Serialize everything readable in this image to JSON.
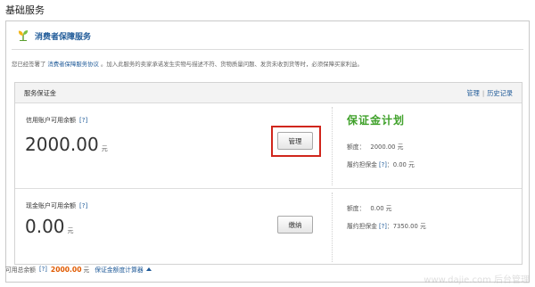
{
  "page": {
    "title": "基础服务"
  },
  "brand": {
    "title": "消费者保障服务",
    "icon": "sprout-icon"
  },
  "notice": {
    "prefix": "您已经签署了",
    "agreement_link": "消费者保障服务协议",
    "suffix": "。加入此服务的卖家承诺发生实物与描述不符、货物质量问题、发货未收到货等时，必须保障买家利益。"
  },
  "panel": {
    "title": "服务保证金",
    "links": [
      {
        "label": "管理"
      },
      {
        "label": "历史记录"
      }
    ]
  },
  "credit": {
    "label": "信用账户可用余额",
    "help": "[?]",
    "amount": "2000.00",
    "unit": "元",
    "button_label": "管理",
    "plan_logo": "保证金计划",
    "quota_label": "额度：",
    "quota_value": "2000.00 元",
    "owed_label": "履约担保金",
    "owed_help": "[?]",
    "owed_value": "：0.00 元"
  },
  "cash": {
    "label": "现金账户可用余额",
    "help": "[?]",
    "amount": "0.00",
    "unit": "元",
    "button_label": "缴纳",
    "quota_label": "额度：",
    "quota_value": "0.00 元",
    "owed_label": "履约担保金",
    "owed_help": "[?]",
    "owed_value": "：7350.00 元"
  },
  "footer": {
    "label": "可用总余额",
    "help": "[?]",
    "total": "2000.00",
    "unit": "元",
    "calculator_link": "保证金额度计算器"
  },
  "watermark": "www.dajie.com 后台管理"
}
